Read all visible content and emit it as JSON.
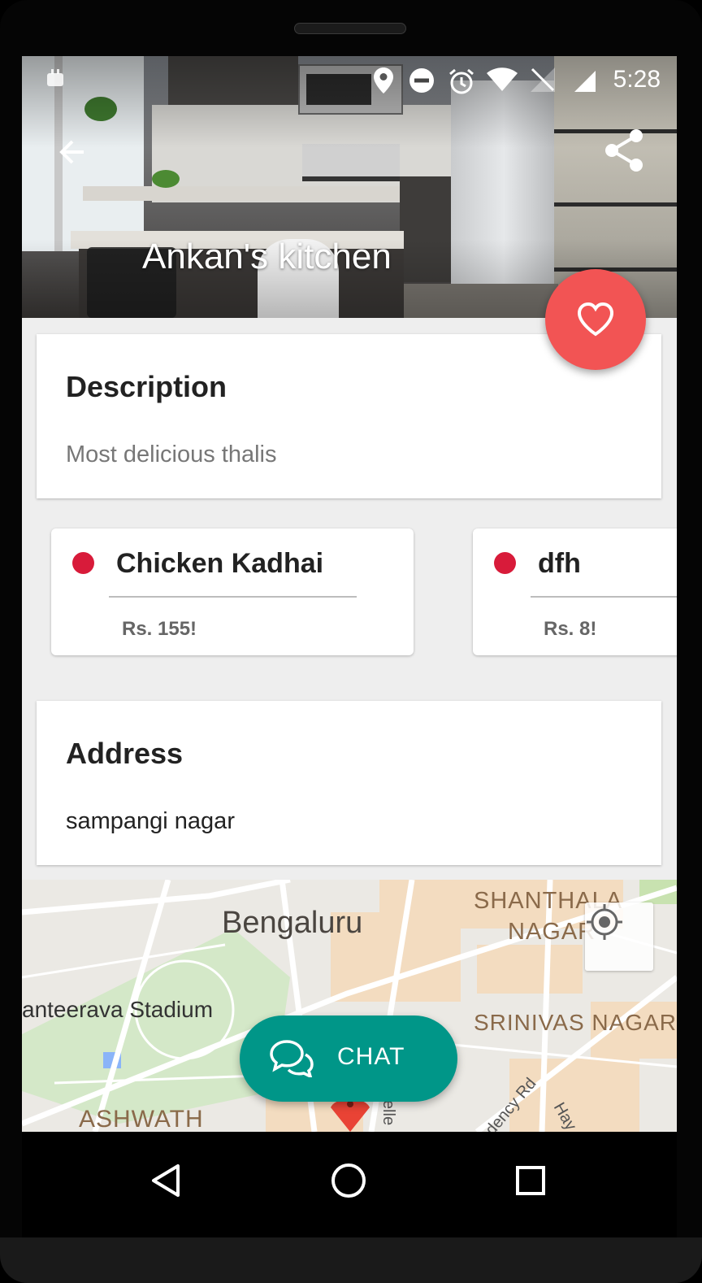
{
  "status_bar": {
    "time": "5:28"
  },
  "header": {
    "title": "Ankan's kitchen"
  },
  "description": {
    "title": "Description",
    "text": "Most delicious thalis"
  },
  "menu_items": [
    {
      "name": "Chicken Kadhai",
      "price": "Rs. 155!"
    },
    {
      "name": "dfh",
      "price": "Rs. 8!"
    }
  ],
  "address": {
    "title": "Address",
    "text": "sampangi nagar"
  },
  "map": {
    "city": "Bengaluru",
    "area_1_line1": "SHANTHALA",
    "area_1_line2": "NAGAR",
    "stadium": "anteerava Stadium",
    "area_2": "SRINIVAS NAGAR",
    "area_3": "ASHWATH",
    "road_1": "dency Rd",
    "road_2": "velle",
    "road_3": "Hay"
  },
  "chat_button": {
    "label": "CHAT"
  },
  "colors": {
    "accent_fab": "#f25454",
    "chat_button": "#009688",
    "veg_dot": "#d81b3a"
  },
  "icons": [
    "back-arrow-icon",
    "share-icon",
    "heart-icon",
    "chat-icon",
    "my-location-icon",
    "map-pin-icon",
    "nav-back-icon",
    "nav-home-icon",
    "nav-recents-icon"
  ]
}
